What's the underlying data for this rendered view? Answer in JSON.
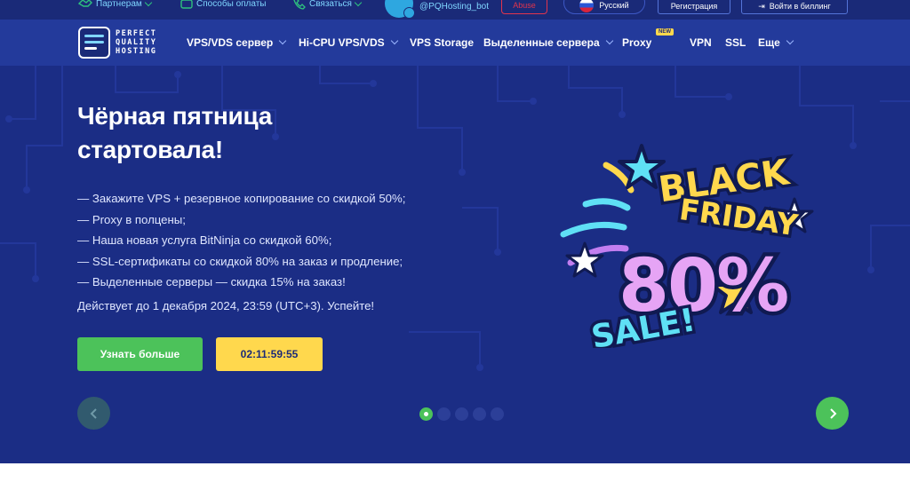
{
  "topbar": {
    "partners_label": "Партнерам",
    "payment_label": "Способы оплаты",
    "contact_label": "Связаться",
    "bot_handle": "@PQHosting_bot",
    "abuse_label": "Abuse",
    "language_label": "Русский",
    "register_label": "Регистрация",
    "login_label": "Войти в биллинг"
  },
  "logo": {
    "line1": "PERFECT",
    "line2": "QUALITY",
    "line3": "HOSTING"
  },
  "nav": {
    "items": [
      {
        "label": "VPS/VDS сервер",
        "dropdown": true
      },
      {
        "label": "Hi-CPU VPS/VDS",
        "dropdown": true
      },
      {
        "label": "VPS Storage",
        "dropdown": false
      },
      {
        "label": "Выделенные сервера",
        "dropdown": true
      },
      {
        "label": "Proxy",
        "dropdown": false,
        "badge": "NEW"
      },
      {
        "label": "VPN",
        "dropdown": false
      },
      {
        "label": "SSL",
        "dropdown": false
      },
      {
        "label": "Еще",
        "dropdown": true
      }
    ]
  },
  "hero": {
    "title_line1": "Чёрная пятница",
    "title_line2": "стартовала!",
    "promos": [
      "— Закажите VPS + резервное копирование со скидкой 50%;",
      "— Proxy в полцены;",
      "— Наша новая услуга BitNinja со скидкой 60%;",
      "— SSL-сертификаты со скидкой 80% на заказ и продление;",
      "— Выделенные серверы — скидка 15% на заказ!"
    ],
    "valid_until": "Действует до 1 декабря 2024, 23:59 (UTC+3). Успейте!",
    "cta_label": "Узнать больше",
    "countdown": "02:11:59:55",
    "slides_total": 5,
    "slide_active": 1
  },
  "banner_art": {
    "line1": "BLACK",
    "line2": "FRIDAY",
    "line3": "80%",
    "line4": "SALE!"
  },
  "colors": {
    "hero_bg": "#1b2d85",
    "nav_bg": "#233a9b",
    "accent_green": "#4cc25a",
    "accent_yellow": "#ffd84d",
    "bf_pink": "#e6a4f5",
    "bf_cyan": "#5fe0f5"
  }
}
